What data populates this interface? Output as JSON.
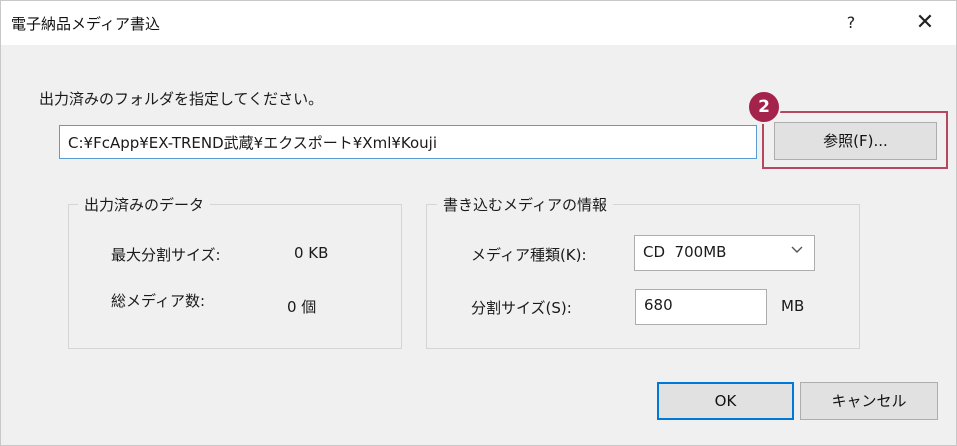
{
  "window": {
    "title": "電子納品メディア書込",
    "help_label": "?",
    "close_label": "✕"
  },
  "instruction": "出力済みのフォルダを指定してください。",
  "path_value": "C:¥FcApp¥EX-TREND武蔵¥エクスポート¥Xml¥Kouji",
  "browse_label": "参照(F)...",
  "step_badge": "2",
  "output_group": {
    "title": "出力済みのデータ",
    "max_split_label": "最大分割サイズ:",
    "max_split_value": "0 KB",
    "media_count_label": "総メディア数:",
    "media_count_value": "0 個"
  },
  "media_group": {
    "title": "書き込むメディアの情報",
    "type_label": "メディア種類(K):",
    "type_value": "CD  700MB",
    "split_label": "分割サイズ(S):",
    "split_value": "680",
    "split_unit": "MB"
  },
  "buttons": {
    "ok": "OK",
    "cancel": "キャンセル"
  },
  "colors": {
    "badge": "#a3234a",
    "highlight_border": "#b5485e",
    "focus_border": "#0078d7"
  },
  "icons": {
    "dropdown": "chevron-down-icon",
    "close": "close-icon",
    "help": "help-icon"
  }
}
